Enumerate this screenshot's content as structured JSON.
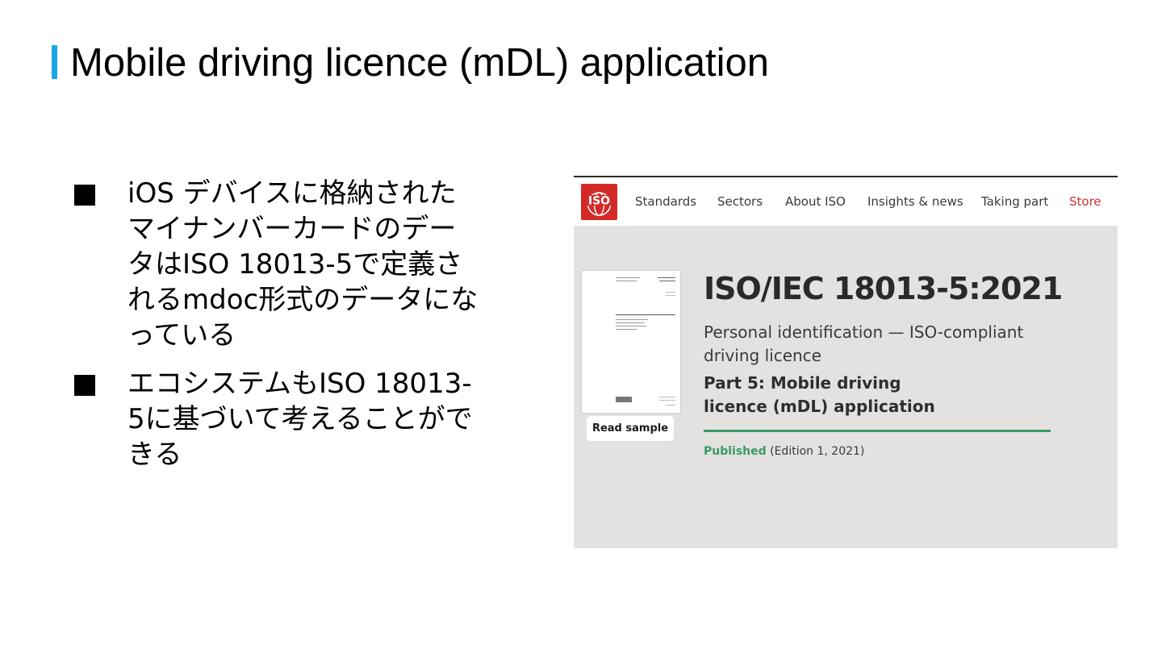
{
  "slide": {
    "title": "Mobile driving licence (mDL) application",
    "bullets": [
      "iOS デバイスに格納されたマイナンバーカードのデータはISO 18013-5で定義されるmdoc形式のデータになっている",
      "エコシステムもISO 18013-5に基づいて考えることができる"
    ]
  },
  "screenshot": {
    "logo_text": "ISO",
    "nav": [
      "Standards",
      "Sectors",
      "About ISO",
      "Insights & news",
      "Taking part",
      "Store"
    ],
    "read_sample_label": "Read sample",
    "standard_code": "ISO/IEC 18013-5:2021",
    "subtitle": "Personal identification — ISO-compliant driving licence",
    "part": "Part 5: Mobile driving licence (mDL) application",
    "status": "Published",
    "edition": "(Edition 1, 2021)"
  },
  "colors": {
    "accent": "#1aa7e8",
    "iso_red": "#d42a27",
    "status_green": "#3a9a62",
    "store_red": "#c8312d"
  }
}
